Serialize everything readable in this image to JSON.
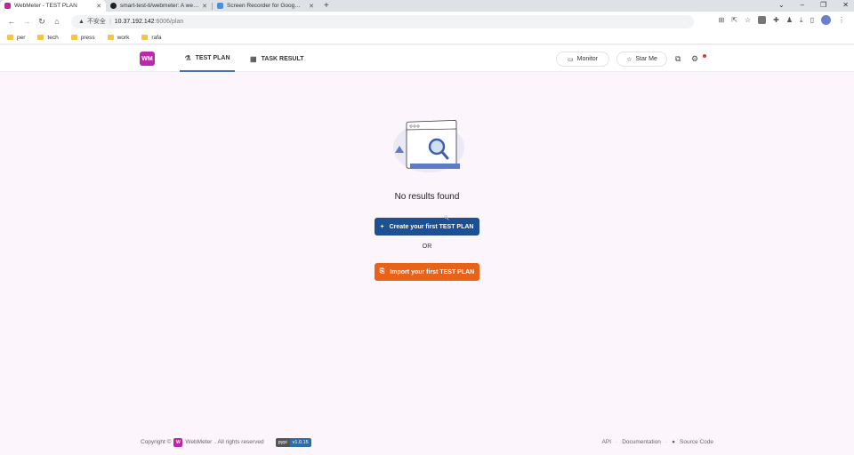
{
  "browser": {
    "tabs": [
      {
        "title": "WebMeter - TEST PLAN",
        "active": true,
        "color": "#c026a8"
      },
      {
        "title": "smart-test-ti/webmeter: A we…",
        "active": false,
        "color": "#222222"
      },
      {
        "title": "Screen Recorder for Goog…",
        "active": false,
        "color": "#4a8fd8"
      }
    ],
    "url_insecure": "不安全",
    "url_host": "10.37.192.142",
    "url_path": ":6006/plan",
    "bookmarks": [
      "per",
      "tech",
      "press",
      "work",
      "rafa"
    ]
  },
  "header": {
    "logo": "WM",
    "tab_test_plan": "TEST PLAN",
    "tab_task_result": "TASK RESULT",
    "monitor_label": "Monitor",
    "star_label": "Star Me"
  },
  "main": {
    "empty_title": "No results found",
    "create_label": "Create your first TEST PLAN",
    "or_label": "OR",
    "import_label": "Import your first TEST PLAN"
  },
  "footer": {
    "copyright": "Copyright ©",
    "brand": "WebMeter",
    "rights": ". All rights reserved",
    "badge_left": "pypi",
    "badge_right": "v1.0.15",
    "links": [
      "API",
      "Documentation",
      "Source Code"
    ]
  },
  "colors": {
    "brand": "#c026a8",
    "primary": "#1d4f93",
    "accent": "#e8621a"
  }
}
